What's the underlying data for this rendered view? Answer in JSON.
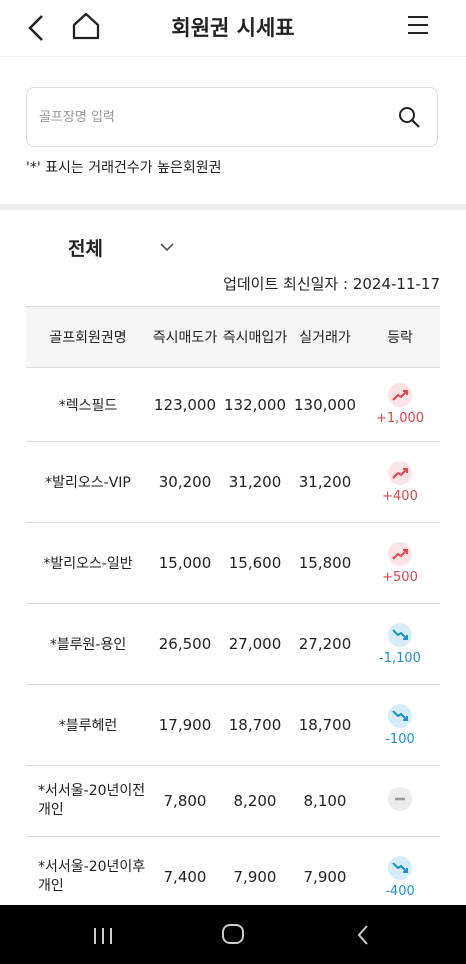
{
  "header": {
    "title": "회원권 시세표",
    "back_icon": "chevron-left-icon",
    "home_icon": "home-icon",
    "menu_icon": "hamburger-menu-icon"
  },
  "search": {
    "placeholder": "골프장명 입력",
    "icon": "search-icon"
  },
  "note": "'*' 표시는 거래건수가 높은회원권",
  "filter": {
    "selected": "전체"
  },
  "update_text": "업데이트 최신일자 : 2024-11-17",
  "table": {
    "headers": [
      "골프회원권명",
      "즉시매도가",
      "즉시매입가",
      "실거래가",
      "등락"
    ],
    "rows": [
      {
        "name": "*렉스필드",
        "sell": "123,000",
        "buy": "132,000",
        "actual": "130,000",
        "change": "+1,000",
        "trend": "up"
      },
      {
        "name": "*발리오스-VIP",
        "sell": "30,200",
        "buy": "31,200",
        "actual": "31,200",
        "change": "+400",
        "trend": "up"
      },
      {
        "name": "*발리오스-일반",
        "sell": "15,000",
        "buy": "15,600",
        "actual": "15,800",
        "change": "+500",
        "trend": "up"
      },
      {
        "name": "*블루원-용인",
        "sell": "26,500",
        "buy": "27,000",
        "actual": "27,200",
        "change": "-1,100",
        "trend": "down"
      },
      {
        "name": "*블루헤런",
        "sell": "17,900",
        "buy": "18,700",
        "actual": "18,700",
        "change": "-100",
        "trend": "down"
      },
      {
        "name": "*서서울-20년이전 개인",
        "sell": "7,800",
        "buy": "8,200",
        "actual": "8,100",
        "change": "",
        "trend": "flat"
      },
      {
        "name": "*서서울-20년이후 개인",
        "sell": "7,400",
        "buy": "7,900",
        "actual": "7,900",
        "change": "-400",
        "trend": "down"
      }
    ]
  },
  "colors": {
    "up": "#e0464c",
    "down": "#1f8fd0",
    "flat": "#999999"
  }
}
